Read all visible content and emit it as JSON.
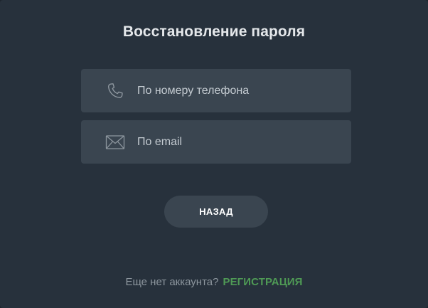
{
  "dialog": {
    "title": "Восстановление пароля"
  },
  "options": [
    {
      "label": "По номеру телефона",
      "icon": "phone-icon"
    },
    {
      "label": "По email",
      "icon": "envelope-icon"
    }
  ],
  "buttons": {
    "back_label": "НАЗАД"
  },
  "footer": {
    "hint": "Еще нет аккаунта?",
    "register_label": "РЕГИСТРАЦИЯ"
  },
  "colors": {
    "background": "#27313c",
    "option_background": "#3a4550",
    "title_text": "#e4e7ea",
    "accent_green": "#4f9a55",
    "muted_text": "#8d969e"
  }
}
